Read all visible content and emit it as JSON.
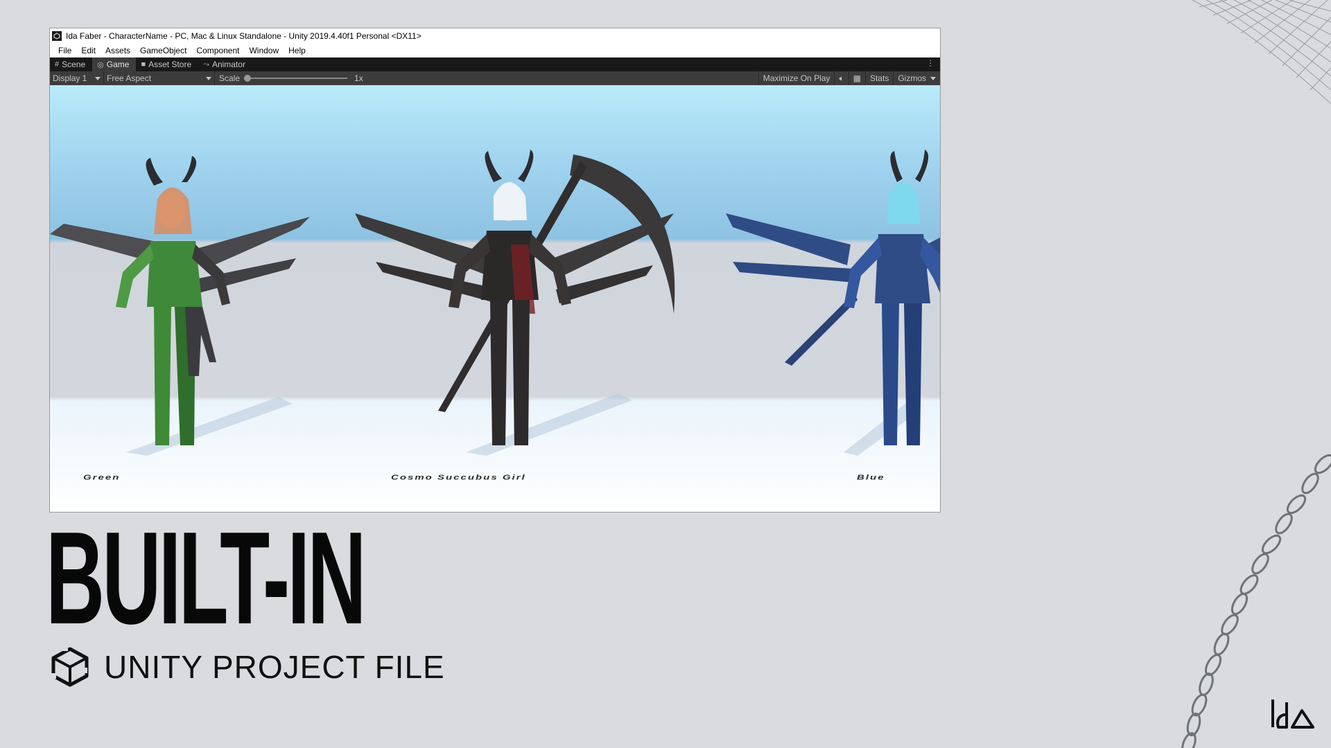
{
  "window": {
    "title": "Ida Faber - CharacterName - PC, Mac & Linux Standalone - Unity 2019.4.40f1 Personal <DX11>"
  },
  "menu": [
    "File",
    "Edit",
    "Assets",
    "GameObject",
    "Component",
    "Window",
    "Help"
  ],
  "tabs": [
    {
      "label": "Scene",
      "icon": "grid-icon"
    },
    {
      "label": "Game",
      "icon": "gamepad-icon",
      "active": true
    },
    {
      "label": "Asset Store",
      "icon": "bag-icon"
    },
    {
      "label": "Animator",
      "icon": "animator-icon"
    }
  ],
  "toolbar": {
    "display": "Display 1",
    "aspect": "Free Aspect",
    "scale_label": "Scale",
    "scale_value": "1x",
    "maximize": "Maximize On Play",
    "stats": "Stats",
    "gizmos": "Gizmos"
  },
  "game_view": {
    "labels": [
      "Green",
      "Cosmo Succubus Girl",
      "Blue"
    ],
    "colors": {
      "green": "#3f8a3a",
      "dark": "#3a3635",
      "blue": "#2f4c86"
    }
  },
  "page": {
    "title": "BUILT-IN",
    "subtitle": "UNITY PROJECT FILE",
    "logo": "ida"
  }
}
